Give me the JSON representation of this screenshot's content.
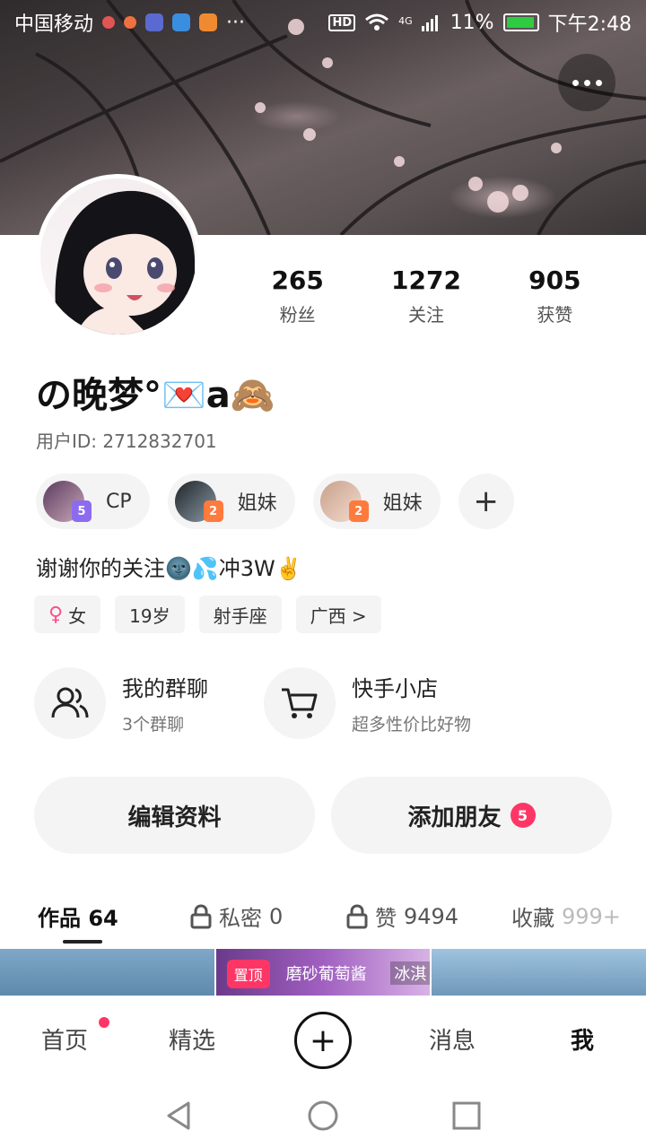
{
  "status_bar": {
    "carrier": "中国移动",
    "network": "4G",
    "hd_label": "HD",
    "battery": "11%",
    "time": "下午2:48"
  },
  "profile": {
    "name": "の晚梦°💌a🙈",
    "uid": "用户ID: 2712832701",
    "bio": "谢谢你的关注🌚💦冲3W✌️"
  },
  "stats": [
    {
      "value": "265",
      "label": "粉丝"
    },
    {
      "value": "1272",
      "label": "关注"
    },
    {
      "value": "905",
      "label": "获赞"
    }
  ],
  "relations": [
    {
      "label": "CP",
      "level": "5",
      "level_color": "#8b6cf0"
    },
    {
      "label": "姐妹",
      "level": "2",
      "level_color": "#ff7a3d"
    },
    {
      "label": "姐妹",
      "level": "2",
      "level_color": "#ff7a3d"
    }
  ],
  "tags": {
    "gender": "女",
    "age": "19岁",
    "zodiac": "射手座",
    "region": "广西 >"
  },
  "features": [
    {
      "title": "我的群聊",
      "subtitle": "3个群聊",
      "icon": "group-icon"
    },
    {
      "title": "快手小店",
      "subtitle": "超多性价比好物",
      "icon": "cart-icon"
    }
  ],
  "actions": {
    "edit": "编辑资料",
    "add_friend": "添加朋友",
    "add_friend_badge": "5"
  },
  "tabs": {
    "works": "作品 64",
    "private_label": "私密",
    "private_count": "0",
    "likes_label": "赞",
    "likes_count": "9494",
    "favorites_label": "收藏",
    "favorites_count": "999+"
  },
  "thumbs": {
    "pinned": "置顶",
    "title": "磨砂葡萄酱",
    "title2": "冰淇"
  },
  "bottom_nav": {
    "home": "首页",
    "featured": "精选",
    "messages": "消息",
    "me": "我"
  },
  "colors": {
    "accent": "#fe3666",
    "chip_bg": "#f4f4f4"
  }
}
